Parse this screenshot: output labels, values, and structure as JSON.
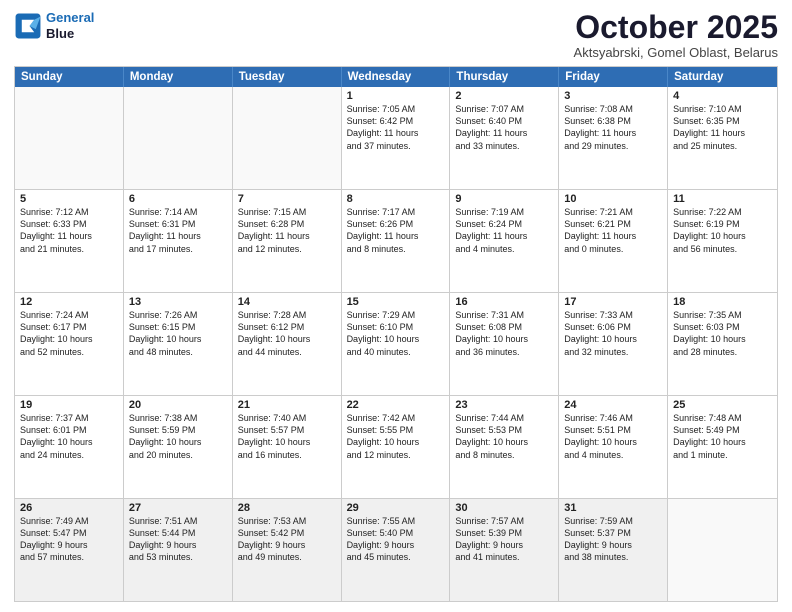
{
  "header": {
    "logo_line1": "General",
    "logo_line2": "Blue",
    "month": "October 2025",
    "location": "Aktsyabrski, Gomel Oblast, Belarus"
  },
  "days_of_week": [
    "Sunday",
    "Monday",
    "Tuesday",
    "Wednesday",
    "Thursday",
    "Friday",
    "Saturday"
  ],
  "weeks": [
    [
      {
        "day": "",
        "text": ""
      },
      {
        "day": "",
        "text": ""
      },
      {
        "day": "",
        "text": ""
      },
      {
        "day": "1",
        "text": "Sunrise: 7:05 AM\nSunset: 6:42 PM\nDaylight: 11 hours\nand 37 minutes."
      },
      {
        "day": "2",
        "text": "Sunrise: 7:07 AM\nSunset: 6:40 PM\nDaylight: 11 hours\nand 33 minutes."
      },
      {
        "day": "3",
        "text": "Sunrise: 7:08 AM\nSunset: 6:38 PM\nDaylight: 11 hours\nand 29 minutes."
      },
      {
        "day": "4",
        "text": "Sunrise: 7:10 AM\nSunset: 6:35 PM\nDaylight: 11 hours\nand 25 minutes."
      }
    ],
    [
      {
        "day": "5",
        "text": "Sunrise: 7:12 AM\nSunset: 6:33 PM\nDaylight: 11 hours\nand 21 minutes."
      },
      {
        "day": "6",
        "text": "Sunrise: 7:14 AM\nSunset: 6:31 PM\nDaylight: 11 hours\nand 17 minutes."
      },
      {
        "day": "7",
        "text": "Sunrise: 7:15 AM\nSunset: 6:28 PM\nDaylight: 11 hours\nand 12 minutes."
      },
      {
        "day": "8",
        "text": "Sunrise: 7:17 AM\nSunset: 6:26 PM\nDaylight: 11 hours\nand 8 minutes."
      },
      {
        "day": "9",
        "text": "Sunrise: 7:19 AM\nSunset: 6:24 PM\nDaylight: 11 hours\nand 4 minutes."
      },
      {
        "day": "10",
        "text": "Sunrise: 7:21 AM\nSunset: 6:21 PM\nDaylight: 11 hours\nand 0 minutes."
      },
      {
        "day": "11",
        "text": "Sunrise: 7:22 AM\nSunset: 6:19 PM\nDaylight: 10 hours\nand 56 minutes."
      }
    ],
    [
      {
        "day": "12",
        "text": "Sunrise: 7:24 AM\nSunset: 6:17 PM\nDaylight: 10 hours\nand 52 minutes."
      },
      {
        "day": "13",
        "text": "Sunrise: 7:26 AM\nSunset: 6:15 PM\nDaylight: 10 hours\nand 48 minutes."
      },
      {
        "day": "14",
        "text": "Sunrise: 7:28 AM\nSunset: 6:12 PM\nDaylight: 10 hours\nand 44 minutes."
      },
      {
        "day": "15",
        "text": "Sunrise: 7:29 AM\nSunset: 6:10 PM\nDaylight: 10 hours\nand 40 minutes."
      },
      {
        "day": "16",
        "text": "Sunrise: 7:31 AM\nSunset: 6:08 PM\nDaylight: 10 hours\nand 36 minutes."
      },
      {
        "day": "17",
        "text": "Sunrise: 7:33 AM\nSunset: 6:06 PM\nDaylight: 10 hours\nand 32 minutes."
      },
      {
        "day": "18",
        "text": "Sunrise: 7:35 AM\nSunset: 6:03 PM\nDaylight: 10 hours\nand 28 minutes."
      }
    ],
    [
      {
        "day": "19",
        "text": "Sunrise: 7:37 AM\nSunset: 6:01 PM\nDaylight: 10 hours\nand 24 minutes."
      },
      {
        "day": "20",
        "text": "Sunrise: 7:38 AM\nSunset: 5:59 PM\nDaylight: 10 hours\nand 20 minutes."
      },
      {
        "day": "21",
        "text": "Sunrise: 7:40 AM\nSunset: 5:57 PM\nDaylight: 10 hours\nand 16 minutes."
      },
      {
        "day": "22",
        "text": "Sunrise: 7:42 AM\nSunset: 5:55 PM\nDaylight: 10 hours\nand 12 minutes."
      },
      {
        "day": "23",
        "text": "Sunrise: 7:44 AM\nSunset: 5:53 PM\nDaylight: 10 hours\nand 8 minutes."
      },
      {
        "day": "24",
        "text": "Sunrise: 7:46 AM\nSunset: 5:51 PM\nDaylight: 10 hours\nand 4 minutes."
      },
      {
        "day": "25",
        "text": "Sunrise: 7:48 AM\nSunset: 5:49 PM\nDaylight: 10 hours\nand 1 minute."
      }
    ],
    [
      {
        "day": "26",
        "text": "Sunrise: 7:49 AM\nSunset: 5:47 PM\nDaylight: 9 hours\nand 57 minutes."
      },
      {
        "day": "27",
        "text": "Sunrise: 7:51 AM\nSunset: 5:44 PM\nDaylight: 9 hours\nand 53 minutes."
      },
      {
        "day": "28",
        "text": "Sunrise: 7:53 AM\nSunset: 5:42 PM\nDaylight: 9 hours\nand 49 minutes."
      },
      {
        "day": "29",
        "text": "Sunrise: 7:55 AM\nSunset: 5:40 PM\nDaylight: 9 hours\nand 45 minutes."
      },
      {
        "day": "30",
        "text": "Sunrise: 7:57 AM\nSunset: 5:39 PM\nDaylight: 9 hours\nand 41 minutes."
      },
      {
        "day": "31",
        "text": "Sunrise: 7:59 AM\nSunset: 5:37 PM\nDaylight: 9 hours\nand 38 minutes."
      },
      {
        "day": "",
        "text": ""
      }
    ]
  ]
}
